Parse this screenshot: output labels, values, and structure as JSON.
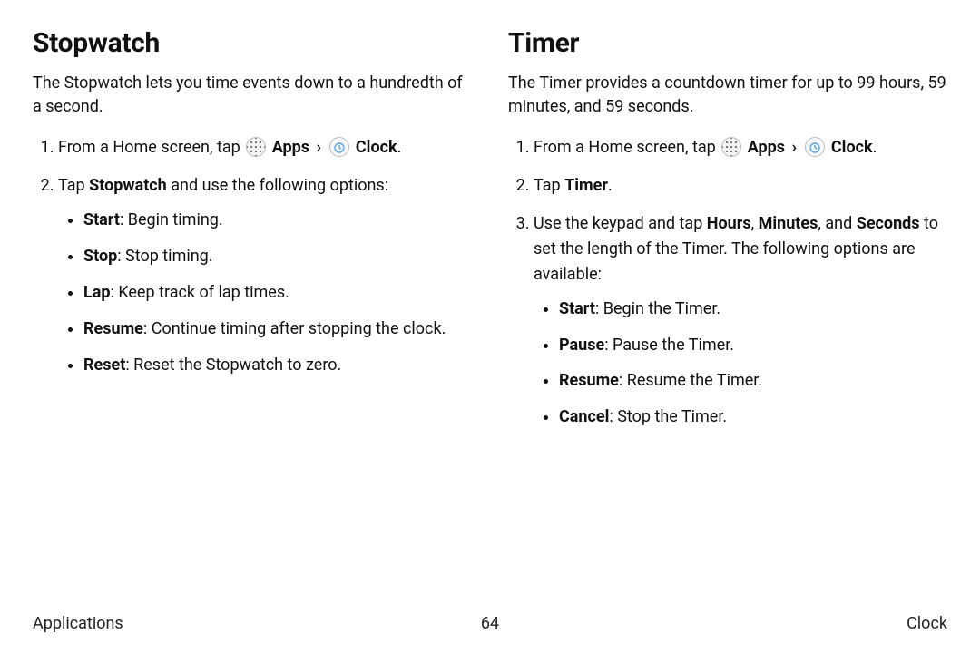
{
  "left": {
    "heading": "Stopwatch",
    "intro": "The Stopwatch lets you time events down to a hundredth of a second.",
    "step1_pre": "From a Home screen, tap ",
    "apps_label": "Apps",
    "clock_label": "Clock",
    "step2_pre": "Tap ",
    "step2_bold": "Stopwatch",
    "step2_post": " and use the following options:",
    "opts": [
      {
        "b": "Start",
        "t": ": Begin timing."
      },
      {
        "b": "Stop",
        "t": ": Stop timing."
      },
      {
        "b": "Lap",
        "t": ": Keep track of lap times."
      },
      {
        "b": "Resume",
        "t": ": Continue timing after stopping the clock."
      },
      {
        "b": "Reset",
        "t": ": Reset the Stopwatch to zero."
      }
    ]
  },
  "right": {
    "heading": "Timer",
    "intro": "The Timer provides a countdown timer for up to 99 hours, 59 minutes, and 59 seconds.",
    "step1_pre": "From a Home screen, tap ",
    "apps_label": "Apps",
    "clock_label": "Clock",
    "step2_pre": "Tap ",
    "step2_bold": "Timer",
    "step2_post": ".",
    "step3_a": "Use the keypad and tap ",
    "step3_b1": "Hours",
    "step3_c": ", ",
    "step3_b2": "Minutes",
    "step3_d": ", and ",
    "step3_b3": "Seconds",
    "step3_e": " to set the length of the Timer. The following options are available:",
    "opts": [
      {
        "b": "Start",
        "t": ": Begin the Timer."
      },
      {
        "b": "Pause",
        "t": ": Pause the Timer."
      },
      {
        "b": "Resume",
        "t": ": Resume the Timer."
      },
      {
        "b": "Cancel",
        "t": ": Stop the Timer."
      }
    ]
  },
  "footer": {
    "left": "Applications",
    "center": "64",
    "right": "Clock"
  }
}
